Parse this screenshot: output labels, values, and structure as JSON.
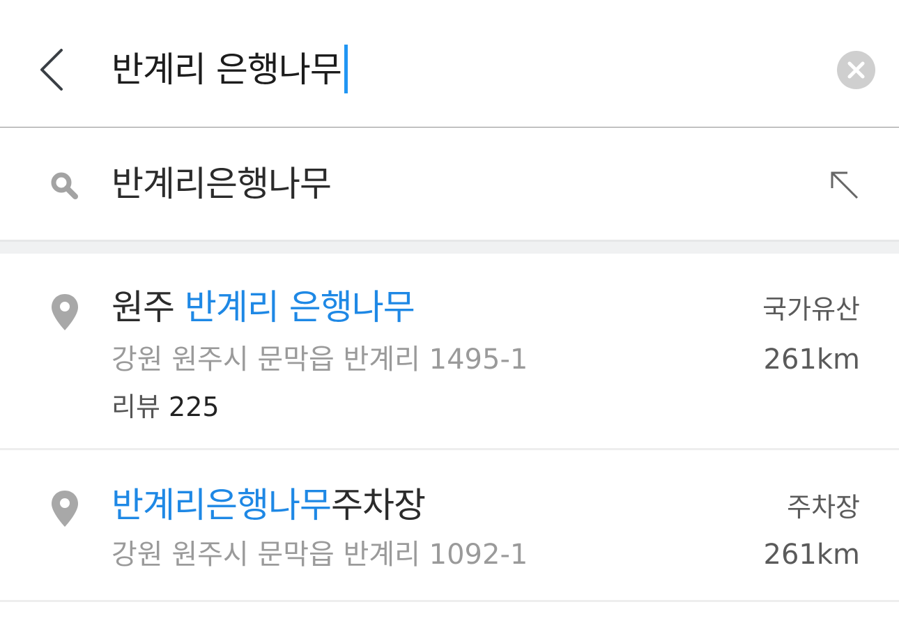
{
  "search": {
    "query": "반계리 은행나무"
  },
  "suggestion": {
    "text": "반계리은행나무"
  },
  "results": [
    {
      "title_prefix": "원주 ",
      "title_highlight": "반계리 은행나무",
      "title_suffix": "",
      "address": "강원 원주시 문막읍 반계리 1495-1",
      "review_label": "리뷰",
      "review_count": "225",
      "category": "국가유산",
      "distance": "261km"
    },
    {
      "title_prefix": "",
      "title_highlight": "반계리은행나무",
      "title_suffix": "주차장",
      "address": "강원 원주시 문막읍 반계리 1092-1",
      "category": "주차장",
      "distance": "261km"
    }
  ],
  "colors": {
    "highlight": "#1e88e5",
    "caret": "#2196f3"
  },
  "icons": {
    "back": "chevron-left-icon",
    "clear": "clear-circle-icon",
    "search": "search-icon",
    "fill_query": "arrow-up-left-icon",
    "place": "map-pin-icon"
  }
}
